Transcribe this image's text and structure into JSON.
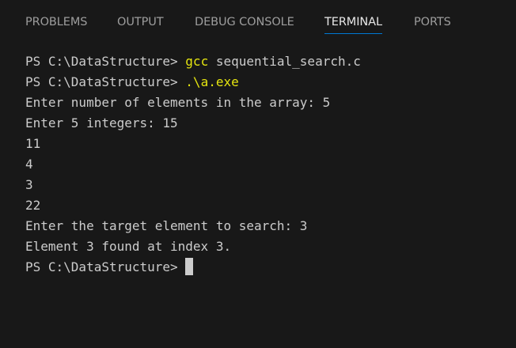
{
  "tabs": [
    {
      "label": "PROBLEMS",
      "active": false
    },
    {
      "label": "OUTPUT",
      "active": false
    },
    {
      "label": "DEBUG CONSOLE",
      "active": false
    },
    {
      "label": "TERMINAL",
      "active": true
    },
    {
      "label": "PORTS",
      "active": false
    }
  ],
  "terminal": {
    "prompt": "PS C:\\DataStructure> ",
    "line1_cmd": "gcc",
    "line1_args": " sequential_search.c",
    "line2_cmd": ".\\a.exe",
    "output": [
      "Enter number of elements in the array: 5",
      "Enter 5 integers: 15",
      "11",
      "4",
      "3",
      "22",
      "Enter the target element to search: 3",
      "Element 3 found at index 3."
    ]
  },
  "colors": {
    "background": "#181818",
    "text": "#cccccc",
    "command": "#e5e510",
    "active_tab_underline": "#0078d4"
  }
}
